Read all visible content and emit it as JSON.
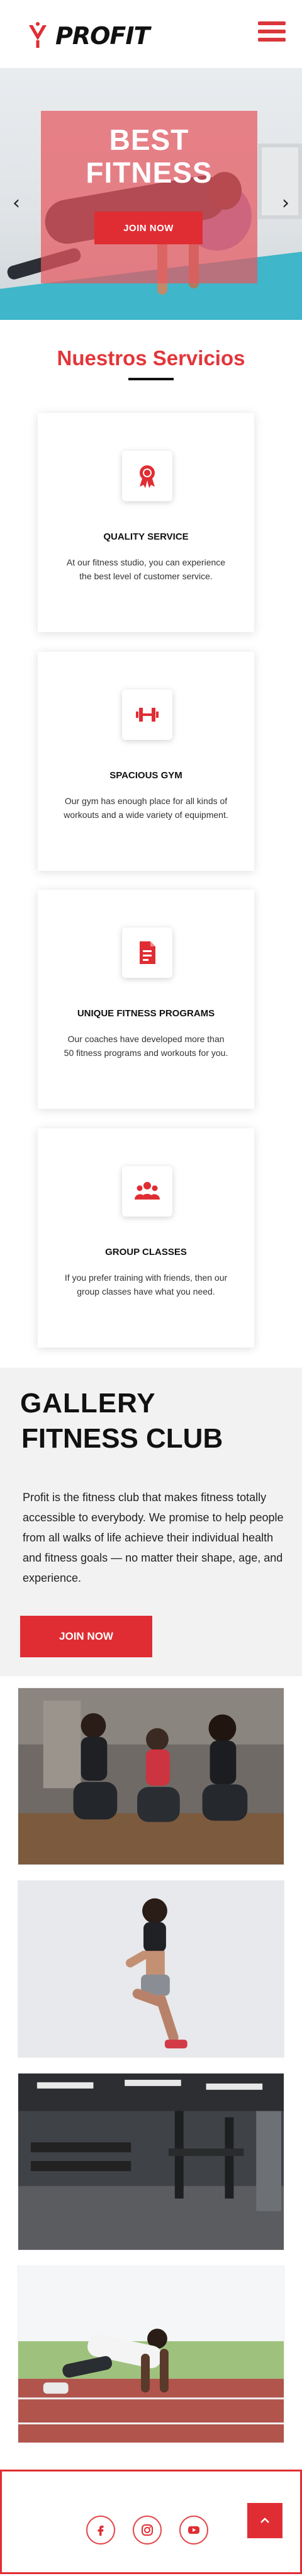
{
  "header": {
    "logo_text": "PROFIT",
    "menu_icon": "hamburger-menu-icon",
    "accent_color": "#e02d33"
  },
  "hero": {
    "title_line1": "BEST",
    "title_line2": "FITNESS",
    "button_label": "JOIN NOW",
    "prev_icon": "chevron-left-icon",
    "next_icon": "chevron-right-icon"
  },
  "services": {
    "title": "Nuestros Servicios",
    "items": [
      {
        "icon": "award-icon",
        "title": "QUALITY SERVICE",
        "text": "At our fitness studio, you can experience the best level of customer service."
      },
      {
        "icon": "dumbbell-icon",
        "title": "SPACIOUS GYM",
        "text": "Our gym has enough place for all kinds of workouts and a wide variety of equipment."
      },
      {
        "icon": "document-icon",
        "title": "UNIQUE FITNESS PROGRAMS",
        "text": "Our coaches have developed more than 50 fitness programs and workouts for you."
      },
      {
        "icon": "group-icon",
        "title": "GROUP CLASSES",
        "text": "If you prefer training with friends, then our group classes have what you need."
      }
    ]
  },
  "gallery": {
    "heading1": "GALLERY",
    "heading2_light": "FITNESS",
    "heading2_bold": "CLUB",
    "text": "Profit is the fitness club that makes fitness totally accessible to everybody. We promise to help people from all walks of life achieve their individual health and fitness goals — no matter their shape, age, and experience.",
    "button_label": "JOIN NOW",
    "photos": [
      "women-stretching-photo",
      "woman-jumping-photo",
      "gym-equipment-photo",
      "sprinter-start-photo"
    ]
  },
  "footer": {
    "social": [
      "facebook-icon",
      "instagram-icon",
      "youtube-icon"
    ],
    "back_to_top_icon": "chevron-up-icon"
  }
}
